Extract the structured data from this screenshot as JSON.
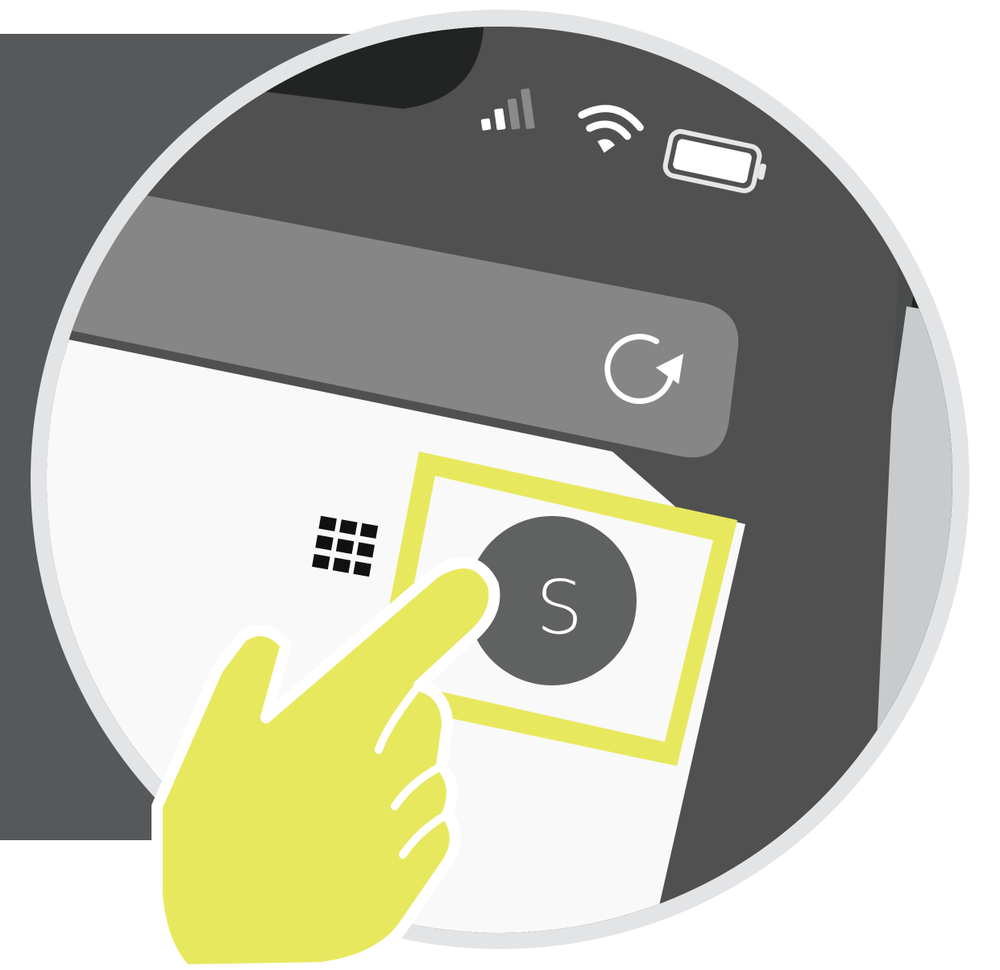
{
  "status_bar": {
    "signal_icon": "cellular-signal-icon",
    "wifi_icon": "wifi-icon",
    "battery_icon": "battery-icon"
  },
  "browser": {
    "reload_icon": "reload-icon"
  },
  "toolbar": {
    "apps_icon": "apps-grid-icon",
    "avatar_initial": "S",
    "avatar_color": "#606161"
  },
  "highlight": {
    "color": "#e8e85f",
    "hand_icon": "pointing-hand-icon"
  }
}
